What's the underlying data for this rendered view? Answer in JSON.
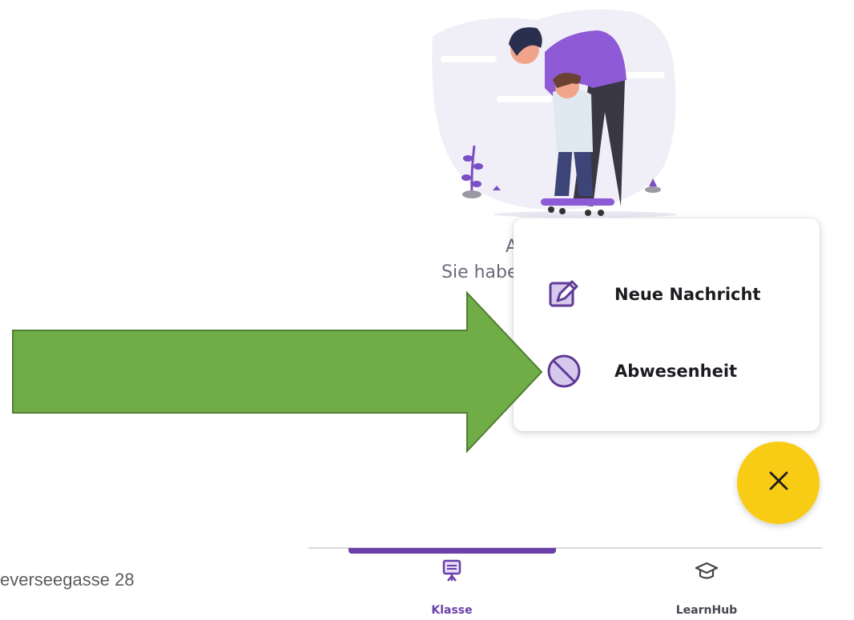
{
  "empty_state": {
    "title": "A",
    "subtitle": "Sie habe"
  },
  "menu": {
    "items": [
      {
        "label": "Neue Nachricht",
        "icon": "edit-icon"
      },
      {
        "label": "Abwesenheit",
        "icon": "block-icon"
      }
    ]
  },
  "fab": {
    "icon": "close-icon"
  },
  "bottom_nav": {
    "items": [
      {
        "label": "Klasse",
        "icon": "classroom-icon",
        "active": true
      },
      {
        "label": "LearnHub",
        "icon": "graduation-cap-icon",
        "active": false
      }
    ]
  },
  "footer": {
    "address": "everseegasse 28"
  },
  "colors": {
    "accent": "#6a3fa8",
    "fab": "#f8cc15",
    "arrow_fill": "#70ad47",
    "arrow_stroke": "#507e32",
    "illustration_bg": "#f0eef7"
  }
}
